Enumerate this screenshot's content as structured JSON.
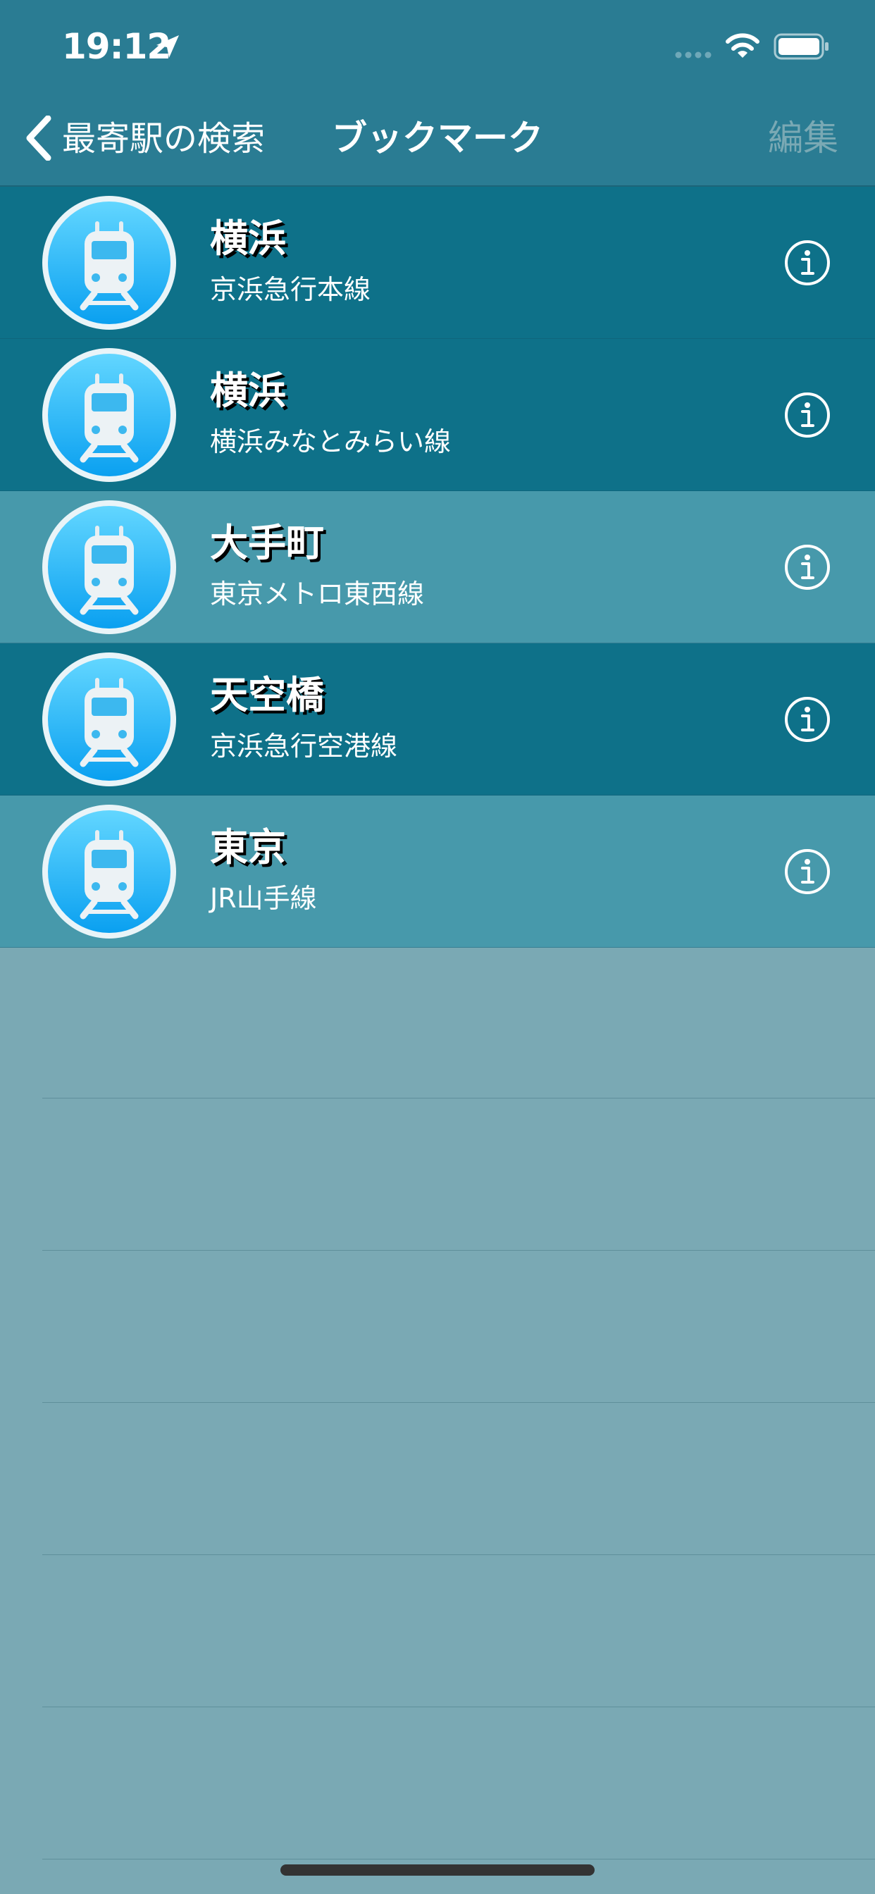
{
  "status_bar": {
    "time": "19:12"
  },
  "nav": {
    "back_label": "最寄駅の検索",
    "title": "ブックマーク",
    "edit_label": "編集"
  },
  "bookmarks": [
    {
      "station": "横浜",
      "line": "京浜急行本線",
      "shade": "dark"
    },
    {
      "station": "横浜",
      "line": "横浜みなとみらい線",
      "shade": "dark"
    },
    {
      "station": "大手町",
      "line": "東京メトロ東西線",
      "shade": "light"
    },
    {
      "station": "天空橋",
      "line": "京浜急行空港線",
      "shade": "dark"
    },
    {
      "station": "東京",
      "line": "JR山手線",
      "shade": "light"
    }
  ],
  "colors": {
    "header_bg": "#2a7c93",
    "row_dark": "#0e7189",
    "row_light": "#4799ab",
    "empty_bg": "#7aa9b4",
    "edit_disabled": "#7aa9b4"
  },
  "icons": {
    "row_icon": "train-icon",
    "row_accessory": "info-icon",
    "back": "chevron-left-icon"
  }
}
